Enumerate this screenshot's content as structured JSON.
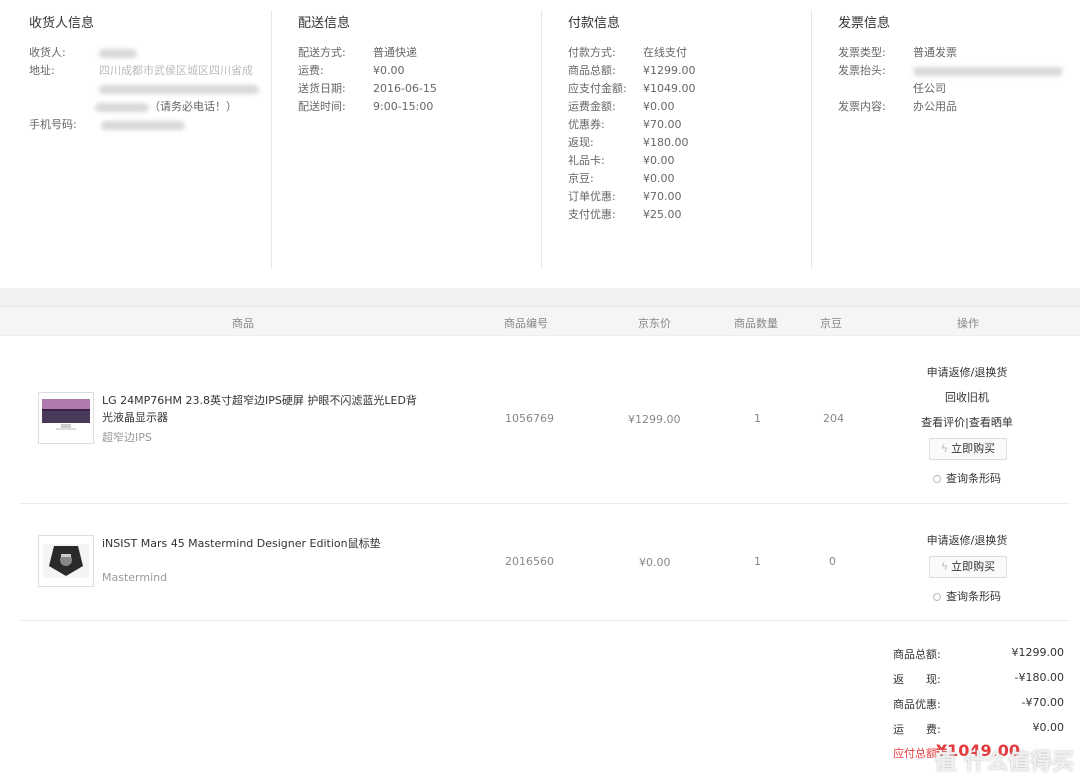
{
  "receiver": {
    "title": "收货人信息",
    "name_label": "收货人:",
    "address_label": "地址:",
    "address_line1": "四川成都市武侯区城区四川省成",
    "address_line2": "（请务必电话！）",
    "phone_label": "手机号码:"
  },
  "delivery": {
    "title": "配送信息",
    "rows": [
      {
        "k": "配送方式:",
        "v": "普通快递"
      },
      {
        "k": "运费:",
        "v": "¥0.00"
      },
      {
        "k": "送货日期:",
        "v": "2016-06-15"
      },
      {
        "k": "配送时间:",
        "v": "9:00-15:00"
      }
    ]
  },
  "payment": {
    "title": "付款信息",
    "rows": [
      {
        "k": "付款方式:",
        "v": "在线支付"
      },
      {
        "k": "商品总额:",
        "v": "¥1299.00"
      },
      {
        "k": "应支付金额:",
        "v": "¥1049.00"
      },
      {
        "k": "运费金额:",
        "v": "¥0.00"
      },
      {
        "k": "优惠券:",
        "v": "¥70.00"
      },
      {
        "k": "返现:",
        "v": "¥180.00"
      },
      {
        "k": "礼品卡:",
        "v": "¥0.00"
      },
      {
        "k": "京豆:",
        "v": "¥0.00"
      },
      {
        "k": "订单优惠:",
        "v": "¥70.00"
      },
      {
        "k": "支付优惠:",
        "v": "¥25.00"
      }
    ]
  },
  "invoice": {
    "title": "发票信息",
    "type_label": "发票类型:",
    "type_value": "普通发票",
    "head_label": "发票抬头:",
    "head_suffix": "任公司",
    "content_label": "发票内容:",
    "content_value": "办公用品"
  },
  "table_header": {
    "product": "商品",
    "code": "商品编号",
    "price": "京东价",
    "qty": "商品数量",
    "beans": "京豆",
    "ops": "操作"
  },
  "items": [
    {
      "name": "LG 24MP76HM 23.8英寸超窄边IPS硬屏 护眼不闪滤蓝光LED背光液晶显示器",
      "sub": "超窄边IPS",
      "code": "1056769",
      "price": "¥1299.00",
      "qty": "1",
      "beans": "204",
      "op1": "申请返修/退换货",
      "op2": "回收旧机",
      "op3": "查看评价|查看晒单",
      "buy": "立即购买",
      "barcode": "查询条形码"
    },
    {
      "name": "iNSIST Mars 45 Mastermind Designer Edition鼠标垫",
      "sub": "Mastermind",
      "code": "2016560",
      "price": "¥0.00",
      "qty": "1",
      "beans": "0",
      "op1": "申请返修/退换货",
      "buy": "立即购买",
      "barcode": "查询条形码"
    }
  ],
  "summary": {
    "total_label": "商品总额:",
    "total_value": "¥1299.00",
    "cash_label": "返　　现:",
    "cash_value": "-¥180.00",
    "promo_label": "商品优惠:",
    "promo_value": "-¥70.00",
    "ship_label": "运　　费:",
    "ship_value": "¥0.00",
    "due_label": "应付总额:",
    "due_value": "¥1049.00"
  },
  "watermark": "值 什么值得买",
  "colors": {
    "accent": "#e4393c"
  }
}
